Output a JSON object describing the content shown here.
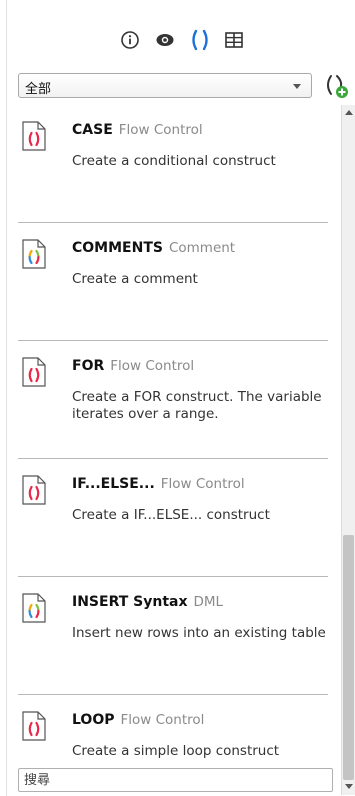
{
  "toolbar": {
    "icons": [
      "info-icon",
      "eye-icon",
      "parentheses-icon",
      "panel-icon"
    ],
    "accent": "#1e6fd9"
  },
  "filter": {
    "selected": "全部"
  },
  "snippets": [
    {
      "title": "CASE",
      "category": "Flow Control",
      "description": "Create a conditional construct",
      "icon": "snippet-red"
    },
    {
      "title": "COMMENTS",
      "category": "Comment",
      "description": "Create a comment",
      "icon": "snippet-multicolor"
    },
    {
      "title": "FOR",
      "category": "Flow Control",
      "description": "Create a FOR construct. The variable iterates over a range.",
      "icon": "snippet-red"
    },
    {
      "title": "IF...ELSE...",
      "category": "Flow Control",
      "description": "Create a IF...ELSE... construct",
      "icon": "snippet-red"
    },
    {
      "title": "INSERT Syntax",
      "category": "DML",
      "description": "Insert new rows into an existing table",
      "icon": "snippet-multicolor"
    },
    {
      "title": "LOOP",
      "category": "Flow Control",
      "description": "Create a simple loop construct",
      "icon": "snippet-red"
    }
  ],
  "search": {
    "placeholder": "搜尋",
    "value": ""
  },
  "colors": {
    "snippet_red": "#e8294a",
    "add_badge": "#3aa83a",
    "separator": "#b8b8b8"
  }
}
